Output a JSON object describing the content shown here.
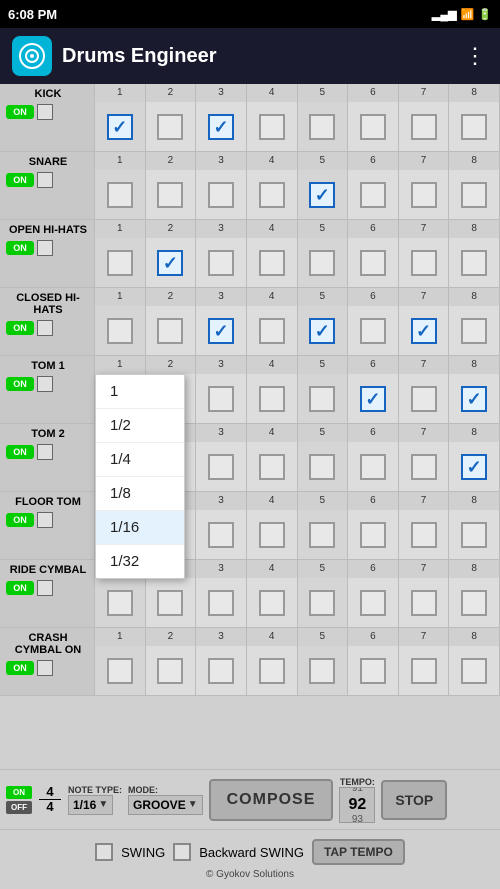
{
  "statusBar": {
    "time": "6:08 PM",
    "battery": "100"
  },
  "header": {
    "title": "Drums Engineer",
    "menuIcon": "⋮"
  },
  "rows": [
    {
      "name": "KICK",
      "beats": [
        true,
        false,
        true,
        false,
        false,
        false,
        false,
        false
      ]
    },
    {
      "name": "SNARE",
      "beats": [
        false,
        false,
        false,
        false,
        true,
        false,
        false,
        false
      ]
    },
    {
      "name": "OPEN HI-HATS",
      "beats": [
        false,
        true,
        false,
        false,
        false,
        false,
        false,
        false
      ]
    },
    {
      "name": "CLOSED HI-HATS",
      "beats": [
        false,
        false,
        true,
        false,
        true,
        false,
        true,
        false
      ]
    },
    {
      "name": "TOM 1",
      "beats": [
        false,
        false,
        false,
        false,
        false,
        true,
        false,
        true
      ]
    },
    {
      "name": "TOM 2",
      "beats": [
        false,
        false,
        false,
        false,
        false,
        false,
        false,
        true
      ]
    },
    {
      "name": "FLOOR TOM",
      "beats": [
        false,
        false,
        false,
        false,
        false,
        false,
        false,
        false
      ]
    },
    {
      "name": "RIDE CYMBAL",
      "beats": [
        false,
        false,
        false,
        false,
        false,
        false,
        false,
        false
      ]
    },
    {
      "name": "CRASH CYMBAL ON",
      "beats": [
        false,
        false,
        false,
        false,
        false,
        false,
        false,
        false
      ]
    }
  ],
  "beatNumbers": [
    1,
    2,
    3,
    4,
    5,
    6,
    7,
    8
  ],
  "dropdown": {
    "items": [
      "1",
      "1/2",
      "1/4",
      "1/8",
      "1/16",
      "1/32"
    ],
    "selected": "1/16"
  },
  "toolbar": {
    "timeSigTop": "4",
    "timeSigBottom": "4",
    "noteTypeLabel": "NOTE TYPE:",
    "noteTypeValue": "1/16",
    "modeLabel": "MODE:",
    "modeValue": "GROOVE",
    "composeLabel": "COMPOSE",
    "tempoLabel": "TEMPO:",
    "tempoPrev": "91",
    "tempoCurrent": "92",
    "tempoNext": "93",
    "stopLabel": "STOP"
  },
  "bottomBar": {
    "swingLabel": "SWING",
    "backwardSwingLabel": "Backward SWING",
    "tapTempoLabel": "TAP TEMPO",
    "copyright": "© Gyokov Solutions"
  }
}
